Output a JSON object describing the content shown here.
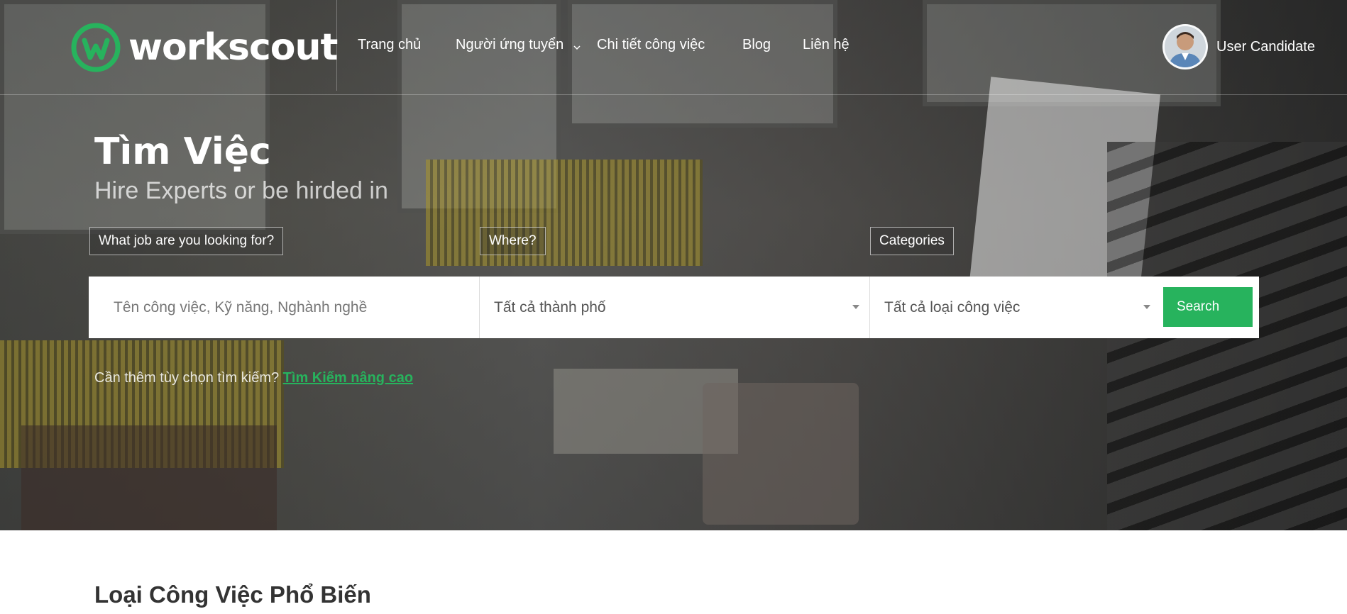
{
  "brand": {
    "name": "workscout",
    "logo_letter": "w",
    "accent_color": "#27b35d"
  },
  "nav": {
    "items": [
      {
        "label": "Trang chủ"
      },
      {
        "label": "Người ứng tuyển",
        "has_dropdown": true
      },
      {
        "label": "Chi tiết công việc"
      },
      {
        "label": "Blog"
      },
      {
        "label": "Liên hệ"
      }
    ]
  },
  "user": {
    "name": "User Candidate",
    "avatar_icon": "user-avatar"
  },
  "hero": {
    "title": "Tìm Việc",
    "subtitle": "Hire Experts or be hirded in"
  },
  "search": {
    "job_label": "What job are you looking for?",
    "where_label": "Where?",
    "categories_label": "Categories",
    "job_placeholder": "Tên công việc, Kỹ năng, Nghành nghề",
    "city_selected": "Tất cả thành phố",
    "category_selected": "Tất cả loại công việc",
    "button_label": "Search"
  },
  "advanced": {
    "prompt": "Cần thêm tùy chọn tìm kiếm? ",
    "link_label": "Tìm Kiếm nâng cao"
  },
  "sections": {
    "popular_categories_title": "Loại Công Việc Phổ Biến"
  }
}
